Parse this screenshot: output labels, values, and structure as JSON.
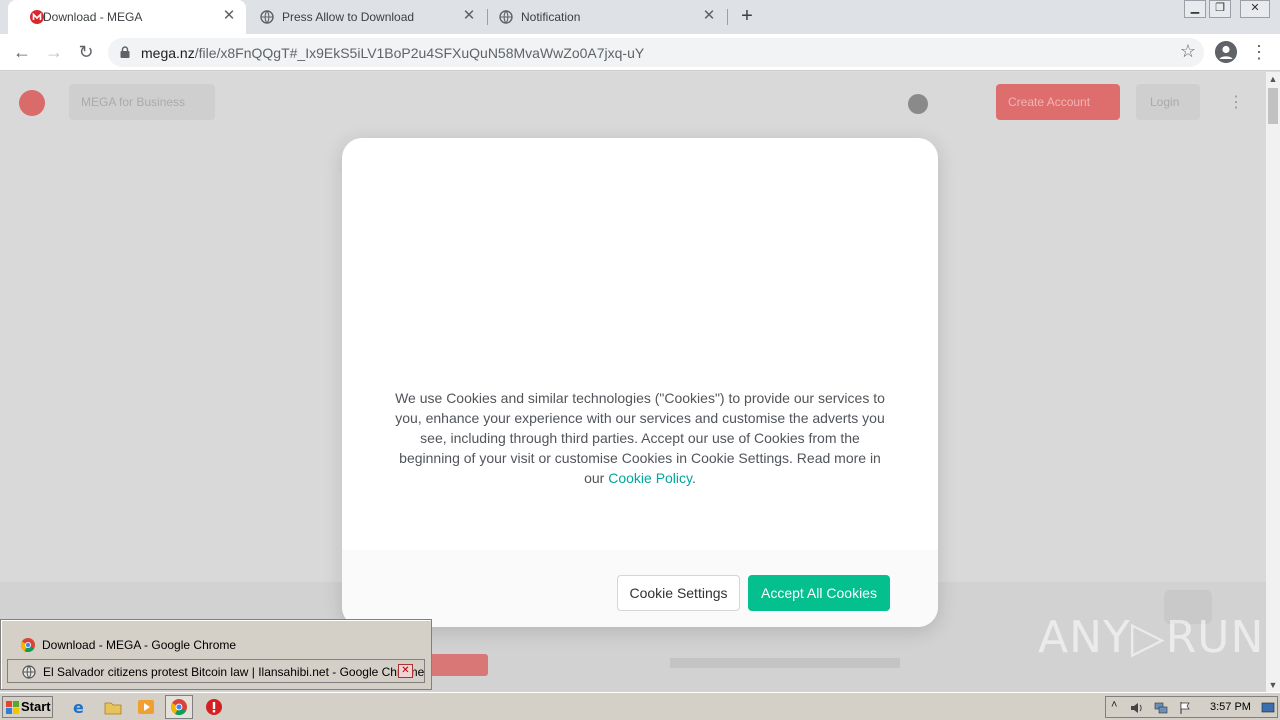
{
  "browser": {
    "tabs": [
      {
        "title": "Download - MEGA",
        "active": true,
        "favicon": "mega-logo-icon"
      },
      {
        "title": "Press Allow to Download",
        "active": false,
        "favicon": "globe-icon"
      },
      {
        "title": "Notification",
        "active": false,
        "favicon": "globe-icon"
      }
    ],
    "url_host": "mega.nz",
    "url_path": "/file/x8FnQQgT#_Ix9EkS5iLV1BoP2u4SFXuQuN58MvaWwZo0A7jxq-uY"
  },
  "page_header": {
    "business_label": "MEGA for Business",
    "create_account_label": "Create Account",
    "login_label": "Login"
  },
  "cookie_dialog": {
    "body_text": "We use Cookies and similar technologies (\"Cookies\") to provide our services to you, enhance your experience with our services and customise the adverts you see, including through third parties. Accept our use of Cookies from the beginning of your visit or customise Cookies in Cookie Settings. Read more in our ",
    "policy_link": "Cookie Policy",
    "trailing": ".",
    "settings_button": "Cookie Settings",
    "accept_button": "Accept All Cookies",
    "accent_color": "#04bf8e"
  },
  "taskbar_popup": {
    "items": [
      {
        "label": "Download - MEGA - Google Chrome"
      },
      {
        "label": "El Salvador citizens protest Bitcoin law | Ilansahibi.net - Google Chrome"
      }
    ]
  },
  "watermark": "ANY▷RUN",
  "taskbar": {
    "start_label": "Start",
    "clock": "3:57 PM"
  }
}
